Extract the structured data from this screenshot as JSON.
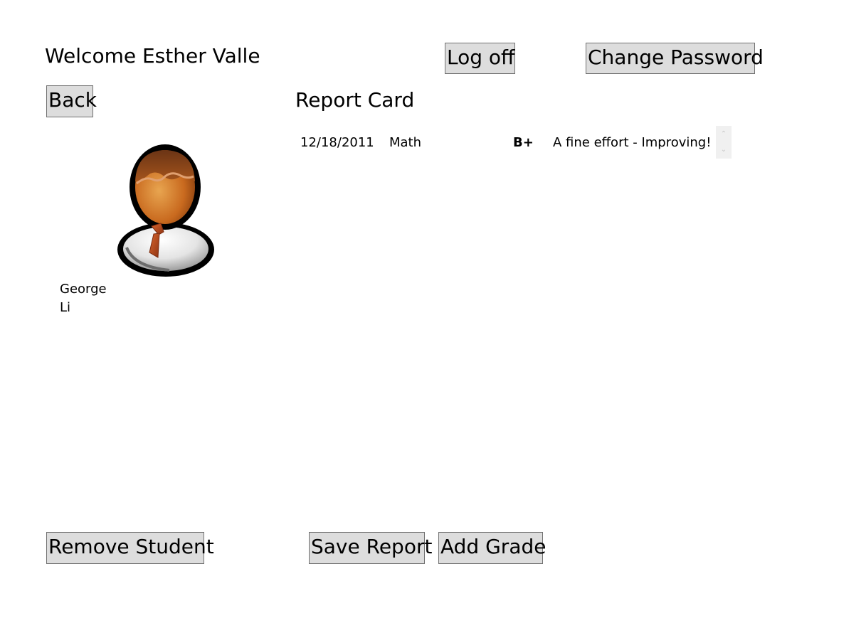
{
  "header": {
    "welcome_text": "Welcome Esther Valle",
    "logoff_label": "Log off",
    "change_password_label": "Change Password"
  },
  "nav": {
    "back_label": "Back"
  },
  "student": {
    "avatar_icon": "student-avatar-icon",
    "first_name": "George",
    "last_name": "Li"
  },
  "report": {
    "title": "Report Card",
    "grades": [
      {
        "date": "12/18/2011",
        "subject": "Math",
        "grade": "B+",
        "comment": "A fine effort - Improving!"
      }
    ]
  },
  "actions": {
    "remove_student_label": "Remove Student",
    "save_report_label": "Save Report",
    "add_grade_label": "Add Grade"
  },
  "colors": {
    "button_bg": "#dddddd",
    "button_border": "#707070",
    "scrollbar_bg": "#f0f0f0"
  }
}
